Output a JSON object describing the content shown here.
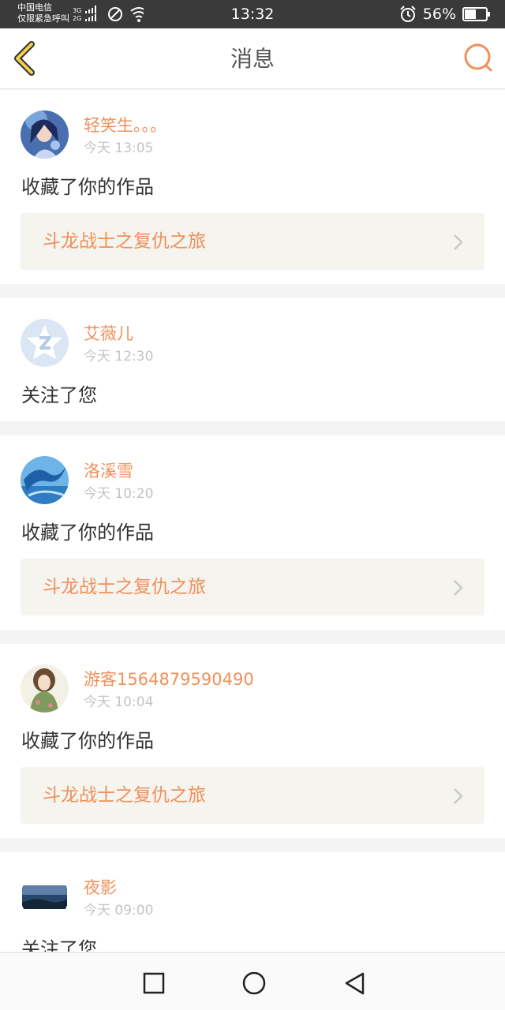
{
  "status_bar": {
    "carrier_line1": "中国电信",
    "carrier_line2": "仅限紧急呼叫",
    "net_top": "3G",
    "net_bottom": "2G",
    "time": "13:32",
    "battery": "56%",
    "icons": [
      "signal-icon",
      "no-sim-icon",
      "wifi-icon",
      "alarm-icon",
      "battery-icon"
    ]
  },
  "header": {
    "title": "消息",
    "back_icon": "chevron-left-icon",
    "search_icon": "search-icon",
    "accent": "#f0905a",
    "back_color": "#f3d14b"
  },
  "messages": [
    {
      "name": "轻笑生。。。",
      "time": "今天 13:05",
      "action": "收藏了你的作品",
      "work": "斗龙战士之复仇之旅",
      "avatar": "anime-girl-avatar"
    },
    {
      "name": "艾薇儿",
      "time": "今天 12:30",
      "action": "关注了您",
      "avatar": "qq-default-avatar"
    },
    {
      "name": "洛溪雪",
      "time": "今天 10:20",
      "action": "收藏了你的作品",
      "work": "斗龙战士之复仇之旅",
      "avatar": "blue-dragon-avatar"
    },
    {
      "name": "游客1564879590490",
      "time": "今天 10:04",
      "action": "收藏了你的作品",
      "work": "斗龙战士之复仇之旅",
      "avatar": "kimono-girl-avatar"
    },
    {
      "name": "夜影",
      "time": "今天 09:00",
      "action": "关注了您",
      "avatar": "night-landscape-avatar"
    }
  ],
  "nav_bar": {
    "icons": [
      "recent-apps-icon",
      "home-icon",
      "back-icon"
    ]
  }
}
